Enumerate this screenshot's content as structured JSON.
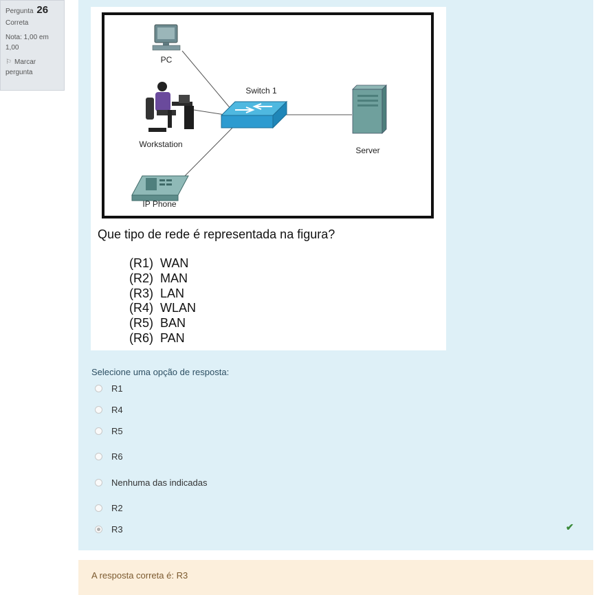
{
  "info": {
    "question_label": "Pergunta",
    "question_number": "26",
    "state": "Correta",
    "grade": "Nota: 1,00 em 1,00",
    "flag_label": "Marcar pergunta"
  },
  "figure": {
    "labels": {
      "pc": "PC",
      "workstation": "Workstation",
      "ip_phone": "IP Phone",
      "switch": "Switch 1",
      "server": "Server"
    },
    "question": "Que tipo de rede é representada na figura?",
    "options": [
      "(R1)  WAN",
      "(R2)  MAN",
      "(R3)  LAN",
      "(R4)  WLAN",
      "(R5)  BAN",
      "(R6)  PAN"
    ]
  },
  "prompt": "Selecione uma opção de resposta:",
  "answers": [
    {
      "label": "R1",
      "selected": false
    },
    {
      "label": "R4",
      "selected": false
    },
    {
      "label": "R5",
      "selected": false
    },
    {
      "label": "R6",
      "selected": false
    },
    {
      "label": "Nenhuma das indicadas",
      "selected": false
    },
    {
      "label": "R2",
      "selected": false
    },
    {
      "label": "R3",
      "selected": true
    }
  ],
  "correct_icon": "checkmark-icon",
  "feedback": "A resposta correta é: R3",
  "colors": {
    "content_bg": "#def0f7",
    "feedback_bg": "#fcefdc",
    "check": "#3a8a3a"
  }
}
